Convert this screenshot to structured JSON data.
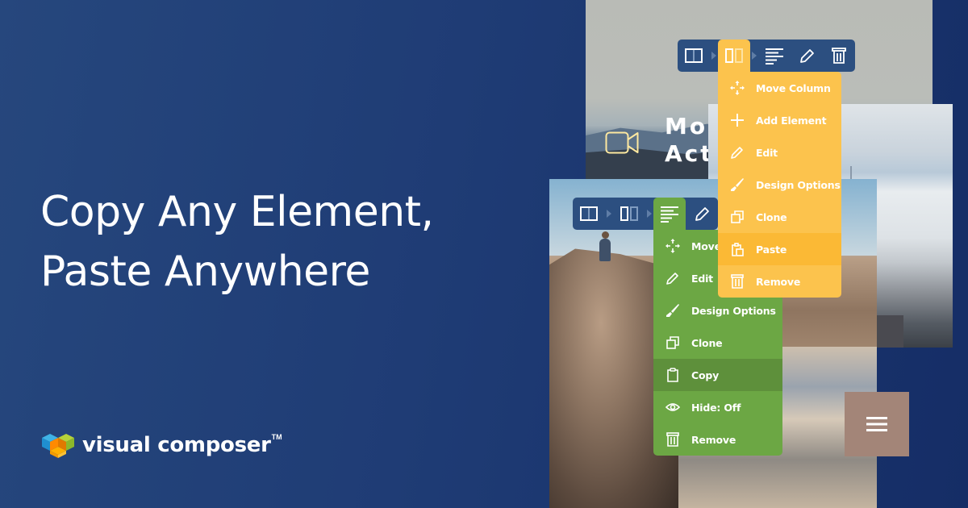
{
  "headline": {
    "line1": "Copy Any Element,",
    "line2": "Paste Anywhere"
  },
  "brand": {
    "name": "visual composer",
    "trademark": "TM",
    "colors": {
      "background_top": "#26477d",
      "background_bottom": "#152d66",
      "toolbar": "#2c4f80",
      "yellow_accent": "#fcc34d",
      "yellow_highlight": "#fbb935",
      "green_accent": "#6ca744",
      "green_highlight": "#5e903b",
      "taupe_block": "#a38578"
    }
  },
  "preview_mountain": {
    "title_line1": "Mor",
    "title_line2": "Act",
    "icon": "video-camera-icon"
  },
  "toolbar_yellow": {
    "items": [
      {
        "icon": "row-layout-icon",
        "active": false
      },
      {
        "icon": "column-layout-icon",
        "active": true
      },
      {
        "icon": "text-block-icon",
        "active": false
      },
      {
        "icon": "pencil-icon",
        "active": false
      },
      {
        "icon": "trash-icon",
        "active": false
      }
    ]
  },
  "menu_yellow": {
    "items": [
      {
        "label": "Move Column",
        "icon": "move-icon"
      },
      {
        "label": "Add Element",
        "icon": "plus-icon"
      },
      {
        "label": "Edit",
        "icon": "pencil-icon"
      },
      {
        "label": "Design Options",
        "icon": "brush-icon"
      },
      {
        "label": "Clone",
        "icon": "clone-icon"
      },
      {
        "label": "Paste",
        "icon": "paste-icon",
        "highlighted": true
      },
      {
        "label": "Remove",
        "icon": "trash-icon"
      }
    ]
  },
  "toolbar_green": {
    "items": [
      {
        "icon": "row-layout-icon",
        "active": false
      },
      {
        "icon": "column-layout-icon",
        "active": false
      },
      {
        "icon": "text-block-icon",
        "active": true
      },
      {
        "icon": "pencil-icon",
        "active": false
      }
    ]
  },
  "menu_green": {
    "items": [
      {
        "label": "Move",
        "icon": "move-icon"
      },
      {
        "label": "Edit",
        "icon": "pencil-icon"
      },
      {
        "label": "Design Options",
        "icon": "brush-icon"
      },
      {
        "label": "Clone",
        "icon": "clone-icon"
      },
      {
        "label": "Copy",
        "icon": "clipboard-icon",
        "highlighted": true
      },
      {
        "label": "Hide: Off",
        "icon": "eye-icon"
      },
      {
        "label": "Remove",
        "icon": "trash-icon"
      }
    ]
  },
  "hamburger": {
    "icon": "hamburger-menu-icon"
  }
}
